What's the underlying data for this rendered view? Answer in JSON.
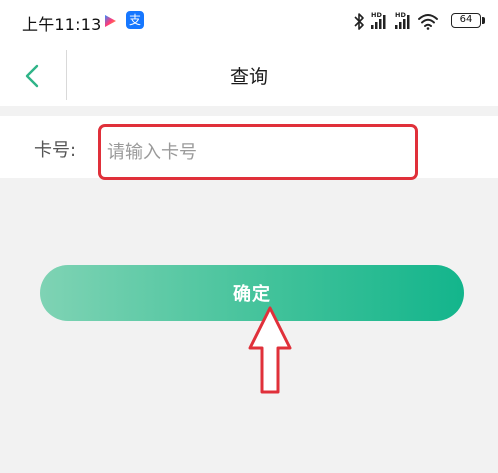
{
  "status_bar": {
    "time": "上午11:13",
    "alipay_glyph": "支",
    "battery_level": "64",
    "network_badges": [
      "HD",
      "HD"
    ],
    "icons": [
      "play-app-icon",
      "alipay-icon",
      "bluetooth-icon",
      "signal-icon",
      "signal-icon",
      "wifi-icon",
      "battery-icon"
    ]
  },
  "nav": {
    "title": "查询",
    "back_icon": "chevron-left-icon",
    "accent_color": "#2fb488"
  },
  "form": {
    "card_label": "卡号:",
    "card_placeholder": "请输入卡号",
    "card_value": "",
    "highlight_color": "#e0303a"
  },
  "actions": {
    "confirm_label": "确定",
    "confirm_color_start": "#7fd3b4",
    "confirm_color_end": "#13b58c"
  },
  "annotation": {
    "arrow_icon": "up-arrow-annotation-icon",
    "arrow_color": "#e0303a"
  }
}
